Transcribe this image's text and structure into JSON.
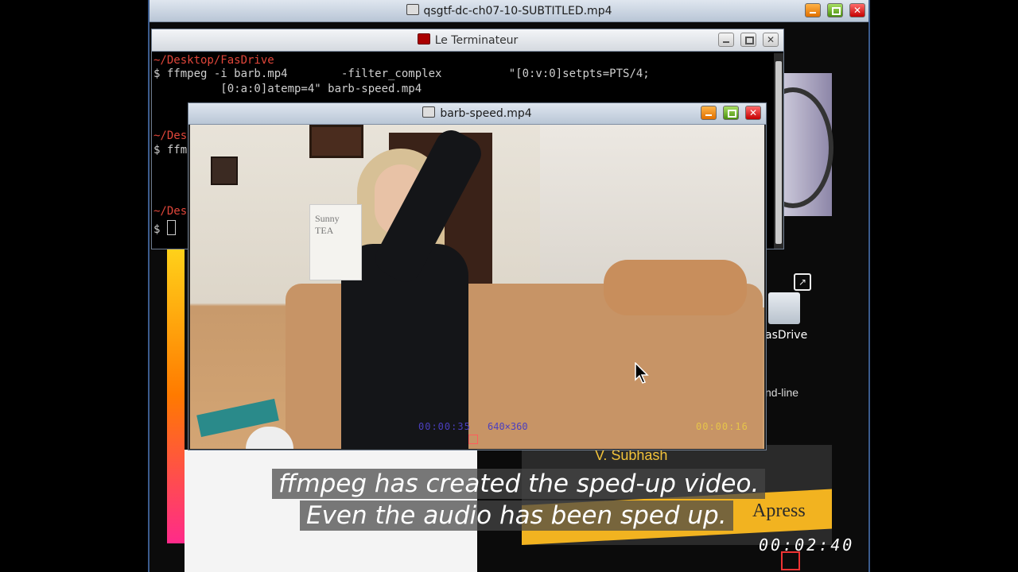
{
  "outer_window": {
    "title": "qsgtf-dc-ch07-10-SUBTITLED.mp4",
    "timer": "00:02:40"
  },
  "terminal": {
    "title": "Le Terminateur",
    "lines": [
      {
        "kind": "path",
        "text": "~/Desktop/FasDrive"
      },
      {
        "kind": "cmd",
        "text": "$ ffmpeg -i barb.mp4        -filter_complex          \"[0:v:0]setpts=PTS/4;"
      },
      {
        "kind": "cmd",
        "text": "          [0:a:0]atemp=4\" barb-speed.mp4"
      },
      {
        "kind": "path",
        "text": "~/Des"
      },
      {
        "kind": "cmd",
        "text": "$ ffm"
      },
      {
        "kind": "path",
        "text": "~/Des"
      },
      {
        "kind": "cmd",
        "text": "$ "
      }
    ]
  },
  "video_window": {
    "title": "barb-speed.mp4",
    "card_text": "Sunny TEA",
    "osd_time": "00:00:35",
    "osd_resolution": "640×360",
    "osd_duration": "00:00:16"
  },
  "desktop": {
    "folder_label": "asDrive",
    "side_text": "nd-line"
  },
  "book": {
    "author": "V. Subhash",
    "publisher": "Apress",
    "spine_text": "V. SUBHASH"
  },
  "subtitles": [
    "ffmpeg has created the sped-up video.",
    "Even the audio has been sped up."
  ],
  "icons": {
    "window_min": "minimize-icon",
    "window_max": "maximize-icon",
    "window_close": "close-icon",
    "pointer": "mouse-pointer-icon"
  }
}
